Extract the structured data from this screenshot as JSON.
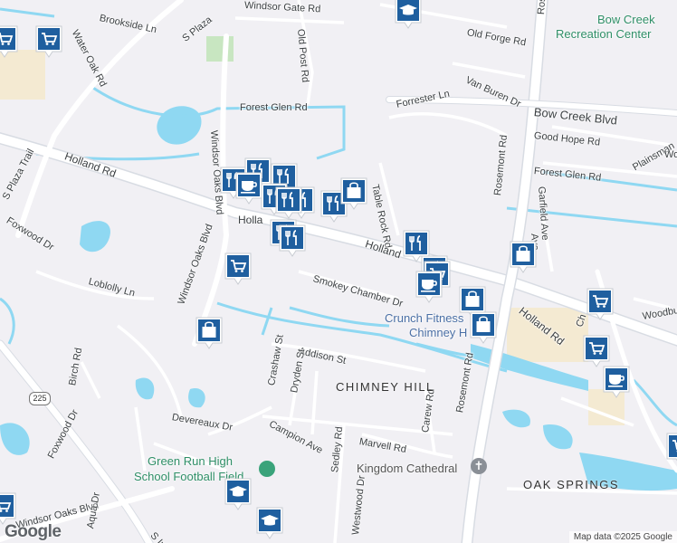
{
  "map": {
    "attribution": "Map data ©2025 Google",
    "logo": "Google",
    "colors": {
      "background": "#f1f0f4",
      "road": "#ffffff",
      "road_casing": "#d8dce3",
      "water": "#8fd8f2",
      "park": "#c8e6c1",
      "commercial": "#f4ead2",
      "marker": "#1f5f9f"
    }
  },
  "street_labels": [
    {
      "text": "Water Oak Rd"
    },
    {
      "text": "Brookside Ln"
    },
    {
      "text": "S Plaza"
    },
    {
      "text": "Windsor Gate Rd"
    },
    {
      "text": "Old Post Rd"
    },
    {
      "text": "Old Forge Rd"
    },
    {
      "text": "Rosemont Rd"
    },
    {
      "text": "Van Buren Dr"
    },
    {
      "text": "Bow Creek Blvd"
    },
    {
      "text": "Forrester Ln"
    },
    {
      "text": "Good Hope Rd"
    },
    {
      "text": "Forest Glen Rd"
    },
    {
      "text": "Forest Glen Rd"
    },
    {
      "text": "Plainsman"
    },
    {
      "text": "Windsor Oaks Blvd"
    },
    {
      "text": "Holland Rd"
    },
    {
      "text": "S Plaza Trail"
    },
    {
      "text": "Foxwood Dr"
    },
    {
      "text": "Loblolly Ln"
    },
    {
      "text": "Windsor Oaks Blvd"
    },
    {
      "text": "Table Rock Rd"
    },
    {
      "text": "Holland"
    },
    {
      "text": "Garfield Ave"
    },
    {
      "text": "Rosemont Rd"
    },
    {
      "text": "Smokey Chamber Dr"
    },
    {
      "text": "Holland Rd"
    },
    {
      "text": "Woodbu"
    },
    {
      "text": "Addison St"
    },
    {
      "text": "Crashaw St"
    },
    {
      "text": "Dryden St"
    },
    {
      "text": "Birch Rd"
    },
    {
      "text": "Devereaux Dr"
    },
    {
      "text": "Campion Ave"
    },
    {
      "text": "Marvell Rd"
    },
    {
      "text": "Carew Rd"
    },
    {
      "text": "Rosemont Rd"
    },
    {
      "text": "Foxwood Dr"
    },
    {
      "text": "Windsor Oaks Blvd"
    },
    {
      "text": "Sedley Rd"
    },
    {
      "text": "Westwood Dr"
    },
    {
      "text": "S Ind"
    },
    {
      "text": "Ave"
    },
    {
      "text": "Holla"
    },
    {
      "text": "Wo"
    },
    {
      "text": "Ch"
    },
    {
      "text": "Aqua Dr"
    }
  ],
  "poi_labels": [
    {
      "text": "Bow Creek"
    },
    {
      "text": "Recreation Center"
    },
    {
      "text": "Crunch Fitness"
    },
    {
      "text": "Chimney H"
    },
    {
      "text": "Kingdom Cathedral"
    },
    {
      "text": "Green Run High"
    },
    {
      "text": "School Football Field"
    }
  ],
  "area_labels": [
    {
      "text": "CHIMNEY HILL"
    },
    {
      "text": "OAK SPRINGS"
    }
  ],
  "route_shield": "225",
  "markers": [
    {
      "icon": "shopping-cart-icon"
    },
    {
      "icon": "shopping-cart-icon"
    },
    {
      "icon": "school-cap-icon"
    },
    {
      "icon": "shopping-cart-icon"
    },
    {
      "icon": "restaurant-icon"
    },
    {
      "icon": "restaurant-icon"
    },
    {
      "icon": "restaurant-icon"
    },
    {
      "icon": "coffee-cup-icon"
    },
    {
      "icon": "restaurant-icon"
    },
    {
      "icon": "restaurant-icon"
    },
    {
      "icon": "restaurant-icon"
    },
    {
      "icon": "restaurant-icon"
    },
    {
      "icon": "shopping-bag-icon"
    },
    {
      "icon": "restaurant-icon"
    },
    {
      "icon": "restaurant-icon"
    },
    {
      "icon": "restaurant-icon"
    },
    {
      "icon": "shopping-cart-icon"
    },
    {
      "icon": "restaurant-icon"
    },
    {
      "icon": "shopping-cart-icon"
    },
    {
      "icon": "coffee-cup-icon"
    },
    {
      "icon": "shopping-bag-icon"
    },
    {
      "icon": "shopping-bag-icon"
    },
    {
      "icon": "shopping-bag-icon"
    },
    {
      "icon": "shopping-bag-icon"
    },
    {
      "icon": "shopping-cart-icon"
    },
    {
      "icon": "shopping-cart-icon"
    },
    {
      "icon": "coffee-cup-icon"
    },
    {
      "icon": "shopping-cart-icon"
    },
    {
      "icon": "school-cap-icon"
    },
    {
      "icon": "school-cap-icon"
    },
    {
      "icon": "shopping-cart-icon"
    }
  ]
}
